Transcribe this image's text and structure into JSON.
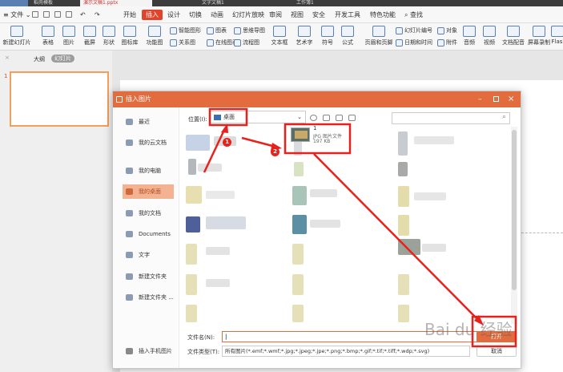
{
  "tabs": [
    {
      "label": "稻壳模板"
    },
    {
      "label": "演示文稿1.pptx"
    },
    {
      "label": "文字文稿1"
    },
    {
      "label": "工作簿1"
    }
  ],
  "menu": {
    "file": "文件",
    "items": [
      "开始",
      "插入",
      "设计",
      "切换",
      "动画",
      "幻灯片放映",
      "审阅",
      "视图",
      "安全",
      "开发工具",
      "特色功能"
    ],
    "active": "插入",
    "search": "查找"
  },
  "ribbon": {
    "new_slide": "新建幻灯片",
    "table": "表格",
    "picture": "图片",
    "screenshot": "截屏",
    "shape": "形状",
    "gallery": "图标库",
    "func": "功能图",
    "smartart": "智能图形",
    "chart": "图表",
    "mindmap": "思维导图",
    "relation": "关系图",
    "online_chart": "在线图表",
    "flowchart": "流程图",
    "textbox": "文本框",
    "wordart": "艺术字",
    "symbol": "符号",
    "formula": "公式",
    "header_footer": "页眉和页脚",
    "slide_number": "幻灯片编号",
    "object": "对象",
    "datetime": "日期和时间",
    "attachment": "附件",
    "audio": "音频",
    "video": "视频",
    "dubbing": "文档配音",
    "recording": "屏幕录制",
    "flash": "Flas"
  },
  "side_tabs": {
    "outline": "大纲",
    "slides": "幻灯片"
  },
  "slide_number": "1",
  "dialog": {
    "title": "插入图片",
    "nav": [
      {
        "label": "最近",
        "icon": "clock-icon"
      },
      {
        "label": "我的云文档",
        "icon": "cloud-icon"
      },
      {
        "label": "我的电脑",
        "icon": "computer-icon"
      },
      {
        "label": "我的桌面",
        "icon": "desktop-icon"
      },
      {
        "label": "我的文档",
        "icon": "document-icon"
      },
      {
        "label": "Documents",
        "icon": "folder-icon"
      },
      {
        "label": "文字",
        "icon": "folder-icon"
      },
      {
        "label": "新建文件夹",
        "icon": "folder-icon"
      },
      {
        "label": "新建文件夹 ...",
        "icon": "folder-icon"
      }
    ],
    "active_nav": "我的桌面",
    "phone_insert": "插入手机图片",
    "location_label": "位置(I):",
    "location_value": "桌面",
    "file": {
      "name": "1",
      "type": "JPG 图片文件",
      "size": "197 KB"
    },
    "filename_label": "文件名(N):",
    "filename_value": "",
    "filetype_label": "文件类型(T):",
    "filetype_value": "所有图片(*.emf;*.wmf;*.jpg;*.jpeg;*.jpe;*.png;*.bmp;*.gif;*.tif;*.tiff;*.wdp;*.svg)",
    "open_label": "打开",
    "cancel_label": "取消"
  },
  "annotations": {
    "badge1": "1",
    "badge2": "2",
    "highlight_color": "#e8211c"
  },
  "watermark": "Bai du 经验"
}
